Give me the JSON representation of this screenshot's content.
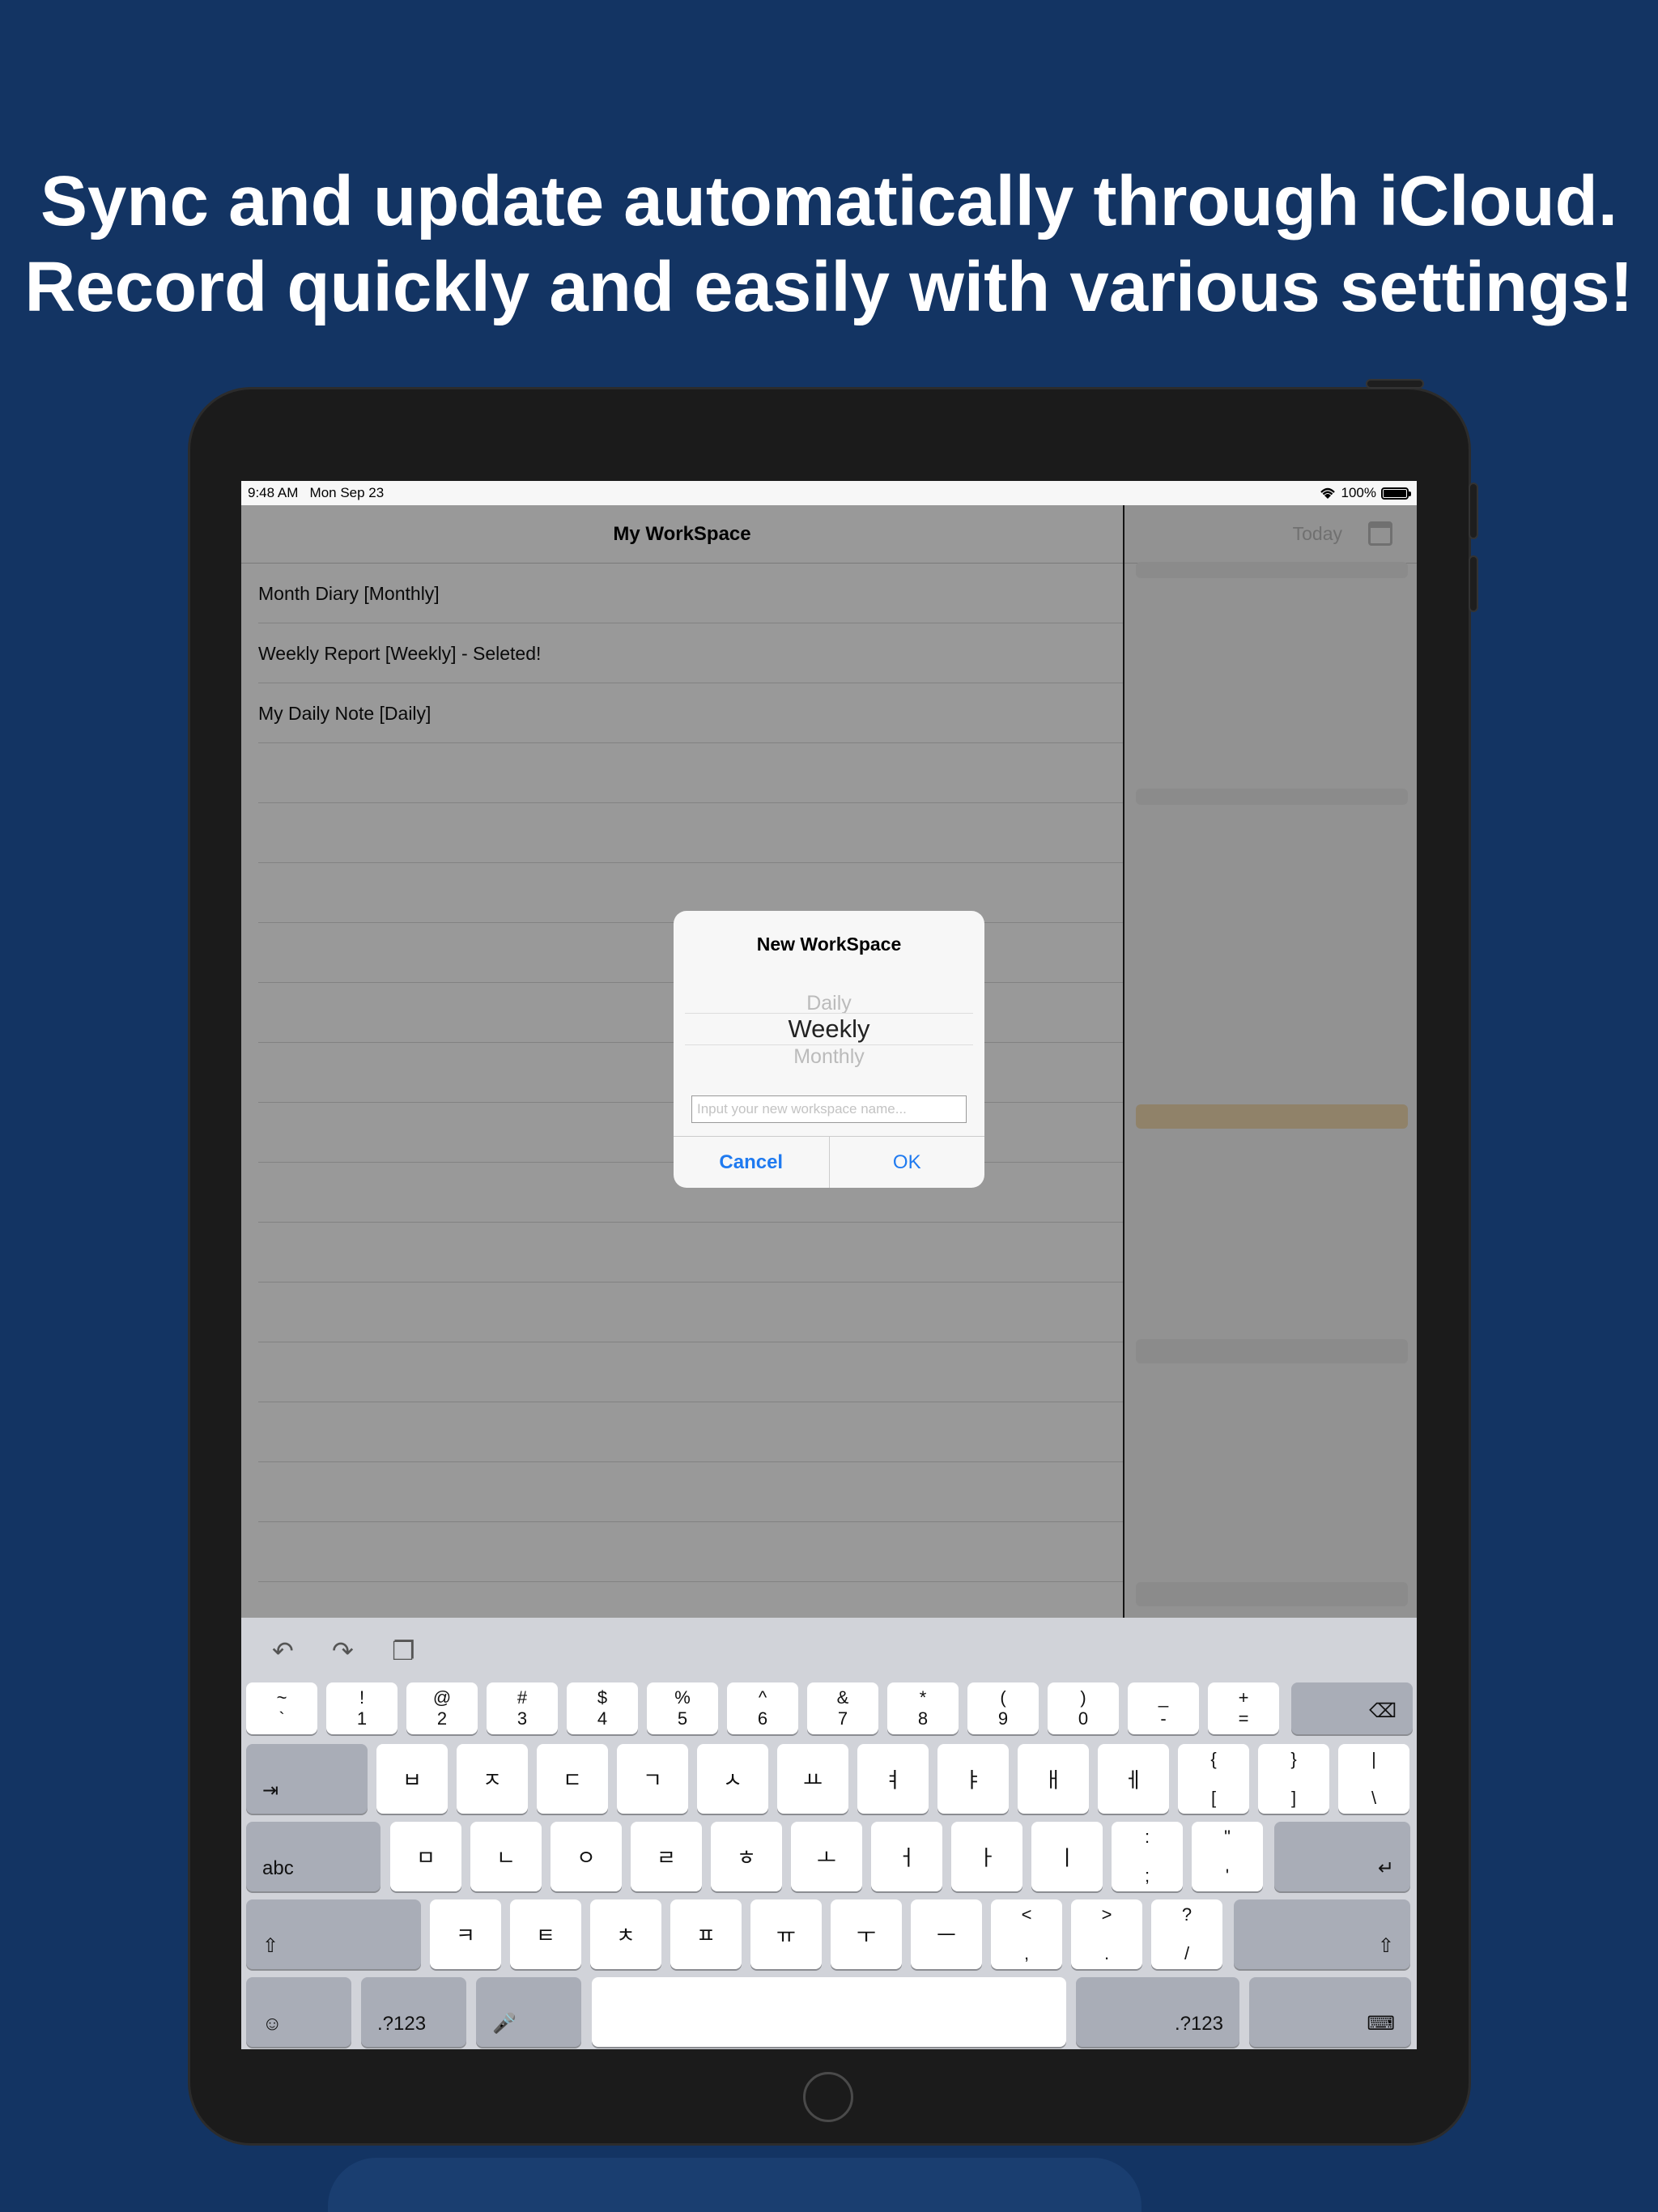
{
  "headline": {
    "line1": "Sync and update automatically through iCloud.",
    "line2": "Record quickly and easily with various settings!"
  },
  "statusbar": {
    "time": "9:48 AM",
    "date": "Mon Sep 23",
    "battery": "100%"
  },
  "master": {
    "title": "My WorkSpace",
    "rows": [
      "Month Diary [Monthly]",
      "Weekly Report [Weekly] - Seleted!",
      "My Daily Note [Daily]"
    ]
  },
  "detail": {
    "today_label": "Today"
  },
  "alert": {
    "title": "New WorkSpace",
    "picker_options": [
      "Daily",
      "Weekly",
      "Monthly"
    ],
    "selected": "Weekly",
    "input_placeholder": "Input your new workspace name...",
    "cancel": "Cancel",
    "ok": "OK"
  },
  "keyboard": {
    "toolbar": [
      "undo-icon",
      "redo-icon",
      "paste-icon"
    ],
    "row1": [
      {
        "top": "~",
        "bot": "`"
      },
      {
        "top": "!",
        "bot": "1"
      },
      {
        "top": "@",
        "bot": "2"
      },
      {
        "top": "#",
        "bot": "3"
      },
      {
        "top": "$",
        "bot": "4"
      },
      {
        "top": "%",
        "bot": "5"
      },
      {
        "top": "^",
        "bot": "6"
      },
      {
        "top": "&",
        "bot": "7"
      },
      {
        "top": "*",
        "bot": "8"
      },
      {
        "top": "(",
        "bot": "9"
      },
      {
        "top": ")",
        "bot": "0"
      },
      {
        "top": "_",
        "bot": "-"
      },
      {
        "top": "+",
        "bot": "="
      }
    ],
    "row2": [
      "ㅂ",
      "ㅈ",
      "ㄷ",
      "ㄱ",
      "ㅅ",
      "ㅛ",
      "ㅕ",
      "ㅑ",
      "ㅐ",
      "ㅔ"
    ],
    "row2_sym": [
      {
        "top": "{",
        "bot": "["
      },
      {
        "top": "}",
        "bot": "]"
      },
      {
        "top": "|",
        "bot": "\\"
      }
    ],
    "row3": [
      "ㅁ",
      "ㄴ",
      "ㅇ",
      "ㄹ",
      "ㅎ",
      "ㅗ",
      "ㅓ",
      "ㅏ",
      "ㅣ"
    ],
    "row3_sym": [
      {
        "top": ":",
        "bot": ";"
      },
      {
        "top": "\"",
        "bot": "'"
      }
    ],
    "row4": [
      "ㅋ",
      "ㅌ",
      "ㅊ",
      "ㅍ",
      "ㅠ",
      "ㅜ",
      "ㅡ"
    ],
    "row4_sym": [
      {
        "top": "<",
        "bot": ","
      },
      {
        "top": ">",
        "bot": "."
      },
      {
        "top": "?",
        "bot": "/"
      }
    ],
    "tab_icon": "⇥",
    "abc_label": "abc",
    "numbers_label": ".?123",
    "numbers_label_right": ".?123"
  }
}
